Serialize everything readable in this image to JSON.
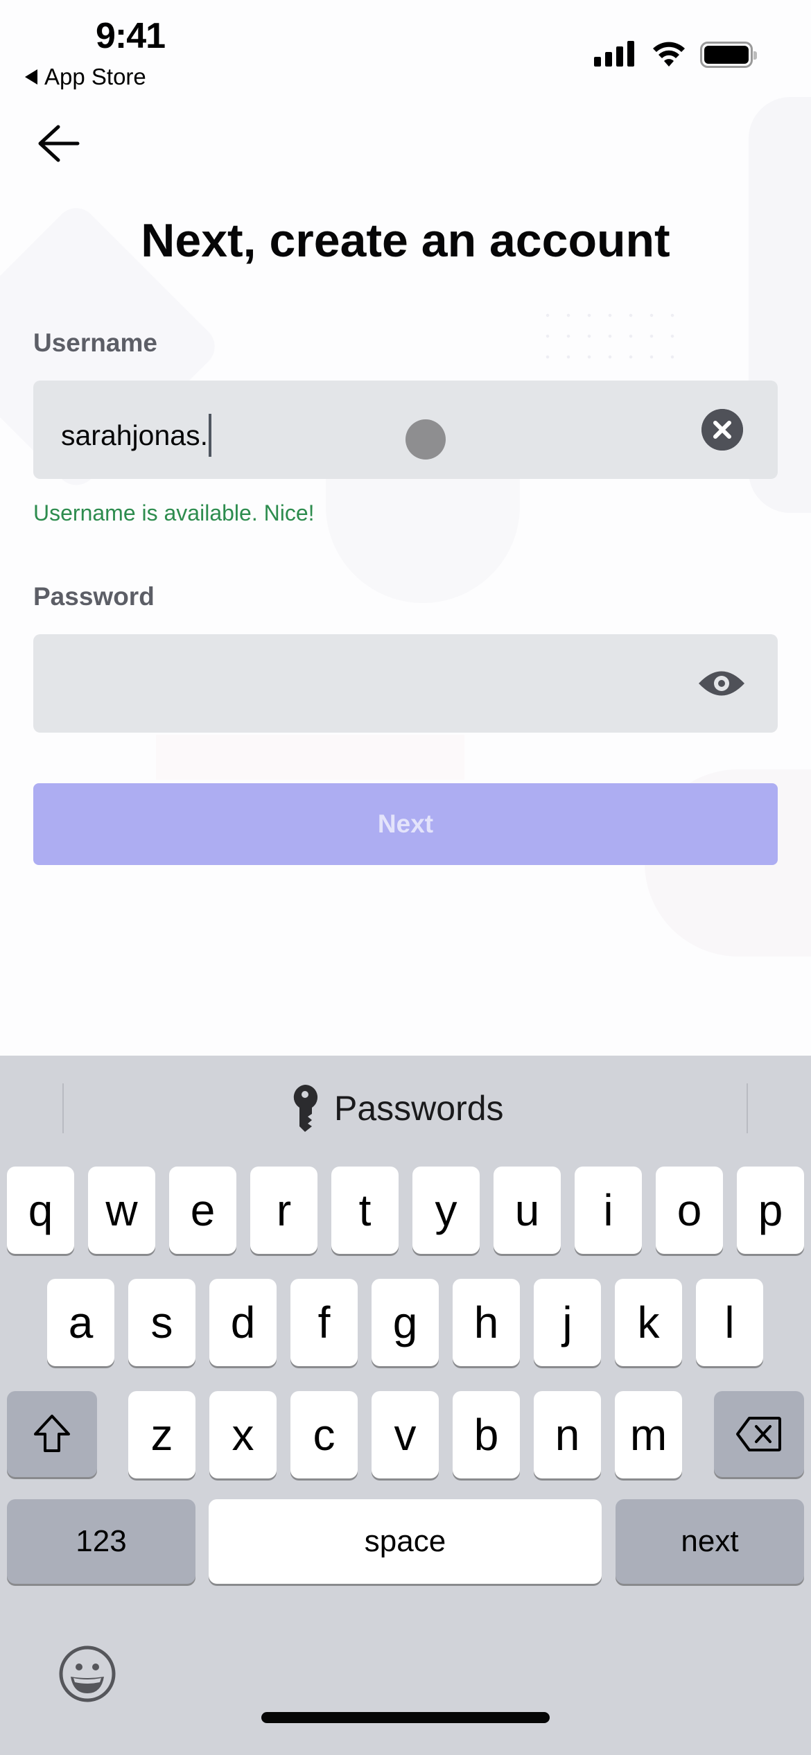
{
  "status_bar": {
    "time": "9:41",
    "back_app": "App Store",
    "signal_icon": "cellular-signal-icon",
    "wifi_icon": "wifi-icon",
    "battery_icon": "battery-icon"
  },
  "header": {
    "back_icon": "arrow-left-icon",
    "title": "Next, create an account"
  },
  "form": {
    "username": {
      "label": "Username",
      "value": "sarahjonas.",
      "clear_icon": "clear-x-icon",
      "status_message": "Username is available. Nice!"
    },
    "password": {
      "label": "Password",
      "value": "",
      "toggle_icon": "eye-icon"
    },
    "submit_label": "Next"
  },
  "colors": {
    "success": "#2d8c4e",
    "button_disabled": "#adadf2",
    "field_bg": "#e3e5e8"
  },
  "keyboard": {
    "suggestion": "Passwords",
    "suggestion_icon": "key-icon",
    "row1": [
      "q",
      "w",
      "e",
      "r",
      "t",
      "y",
      "u",
      "i",
      "o",
      "p"
    ],
    "row2": [
      "a",
      "s",
      "d",
      "f",
      "g",
      "h",
      "j",
      "k",
      "l"
    ],
    "row3": [
      "z",
      "x",
      "c",
      "v",
      "b",
      "n",
      "m"
    ],
    "shift_icon": "shift-icon",
    "delete_icon": "delete-backspace-icon",
    "numbers_label": "123",
    "space_label": "space",
    "return_label": "next",
    "emoji_icon": "emoji-smile-icon"
  }
}
